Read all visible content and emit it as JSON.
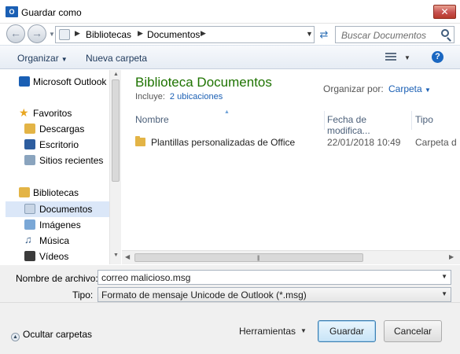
{
  "window": {
    "title": "Guardar como",
    "icon": "outlook-app-icon",
    "close_label": "✕"
  },
  "address": {
    "segments": [
      "Bibliotecas",
      "Documentos"
    ],
    "search_placeholder": "Buscar Documentos"
  },
  "toolbar": {
    "organize": "Organizar",
    "new_folder": "Nueva carpeta"
  },
  "nav": {
    "items": [
      {
        "label": "Microsoft Outlook",
        "icon": "outlook-icon"
      },
      {
        "label": "Favoritos",
        "icon": "star-icon"
      },
      {
        "label": "Descargas",
        "icon": "download-folder-icon"
      },
      {
        "label": "Escritorio",
        "icon": "desktop-icon"
      },
      {
        "label": "Sitios recientes",
        "icon": "recent-places-icon"
      },
      {
        "label": "Bibliotecas",
        "icon": "libraries-icon"
      },
      {
        "label": "Documentos",
        "icon": "documents-icon",
        "selected": true
      },
      {
        "label": "Imágenes",
        "icon": "pictures-icon"
      },
      {
        "label": "Música",
        "icon": "music-icon"
      },
      {
        "label": "Vídeos",
        "icon": "videos-icon"
      }
    ]
  },
  "library": {
    "title": "Biblioteca Documentos",
    "includes_label": "Incluye:",
    "includes_link": "2 ubicaciones",
    "arrange_label": "Organizar por:",
    "arrange_value": "Carpeta"
  },
  "columns": [
    "Nombre",
    "Fecha de modifica...",
    "Tipo"
  ],
  "files": [
    {
      "name": "Plantillas personalizadas de Office",
      "date": "22/01/2018 10:49",
      "type": "Carpeta d"
    }
  ],
  "form": {
    "filename_label": "Nombre de archivo:",
    "filename_value": "correo malicioso.msg",
    "type_label": "Tipo:",
    "type_value": "Formato de mensaje Unicode de Outlook (*.msg)"
  },
  "footer": {
    "hide_folders": "Ocultar carpetas",
    "tools": "Herramientas",
    "save": "Guardar",
    "cancel": "Cancelar"
  }
}
